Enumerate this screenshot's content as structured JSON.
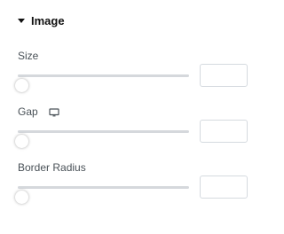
{
  "section": {
    "title": "Image"
  },
  "controls": [
    {
      "label": "Size",
      "value": "",
      "slider_fraction": 0
    },
    {
      "label": "Gap",
      "value": "",
      "slider_fraction": 0,
      "icon": "desktop-monitor-icon"
    },
    {
      "label": "Border Radius",
      "value": "",
      "slider_fraction": 0
    }
  ],
  "colors": {
    "track": "#d5d8dc",
    "title": "#111111",
    "label": "#495157",
    "input_border": "#d5dadf"
  }
}
